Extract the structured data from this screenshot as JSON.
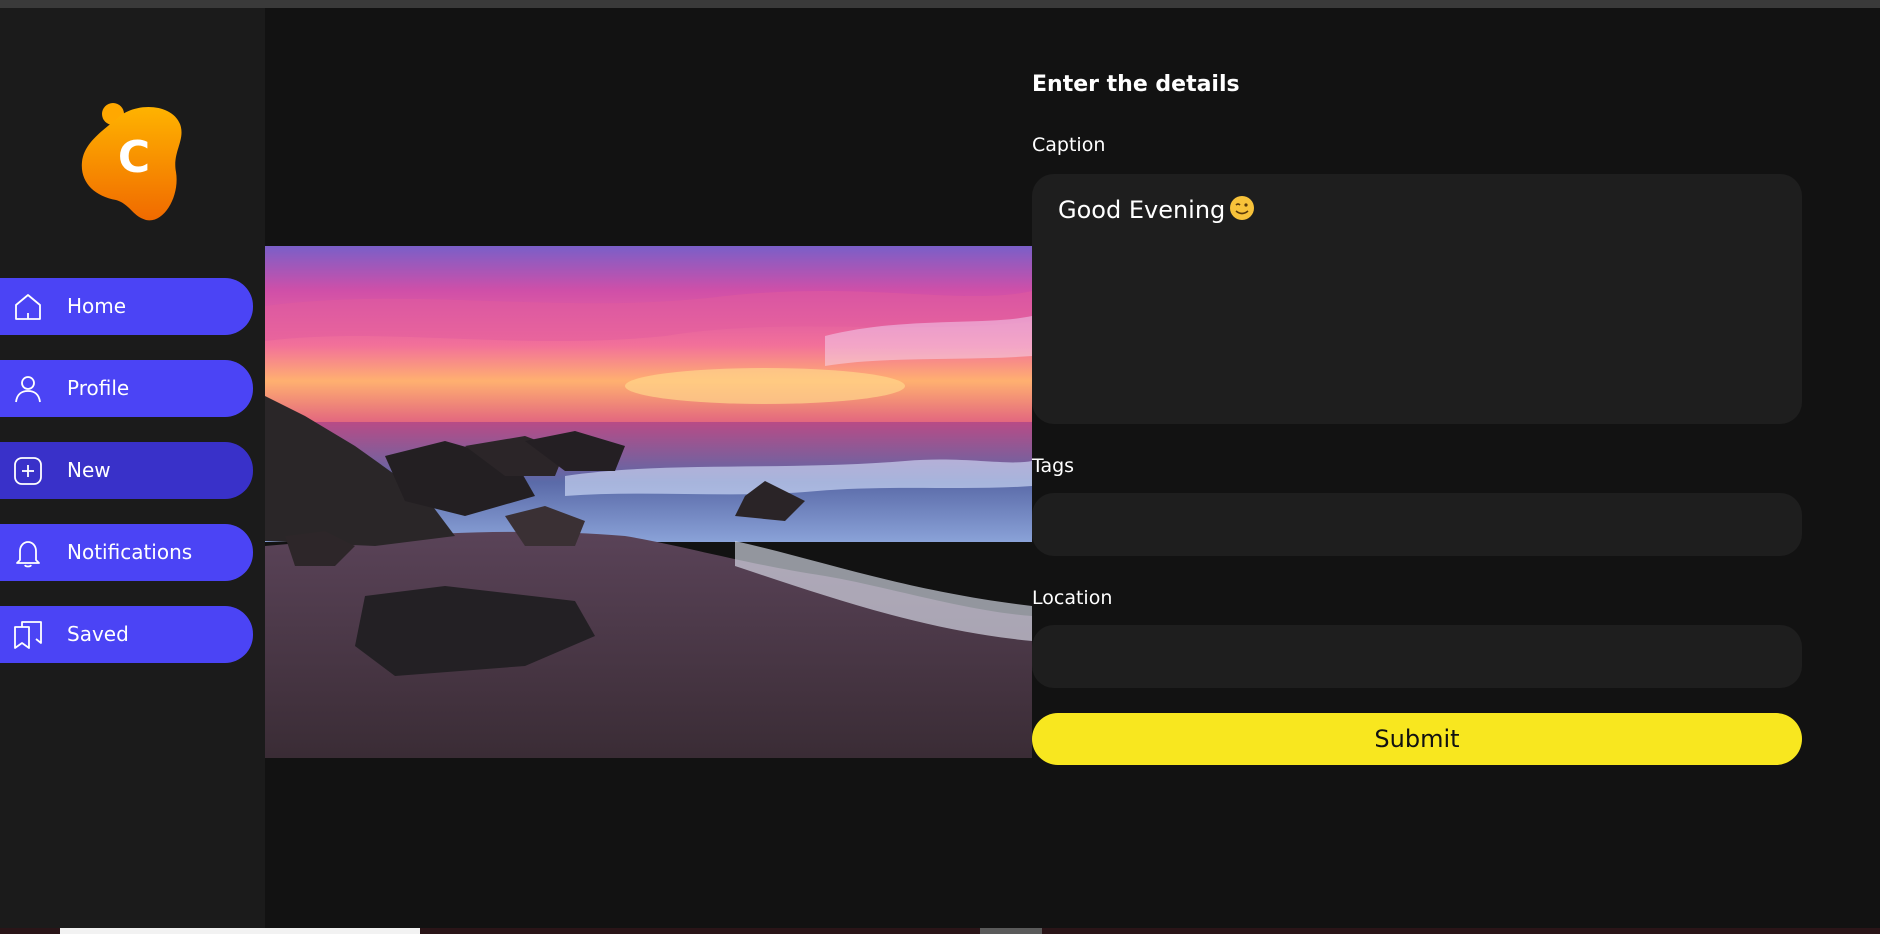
{
  "sidebar": {
    "logo_letter": "C",
    "items": [
      {
        "label": "Home",
        "icon": "home-icon"
      },
      {
        "label": "Profile",
        "icon": "user-icon"
      },
      {
        "label": "New",
        "icon": "plus-square-icon"
      },
      {
        "label": "Notifications",
        "icon": "bell-icon"
      },
      {
        "label": "Saved",
        "icon": "bookmark-icon"
      }
    ]
  },
  "form": {
    "title": "Enter the details",
    "caption_label": "Caption",
    "caption_value": "Good Evening",
    "caption_emoji": "winking-face-icon",
    "tags_label": "Tags",
    "tags_value": "",
    "location_label": "Location",
    "location_value": "",
    "submit_label": "Submit"
  },
  "colors": {
    "accent": "#4b44f5",
    "accent_active": "#3931c9",
    "submit": "#f8e71f",
    "background": "#121212",
    "sidebar": "#1b1b1b",
    "field": "#1e1e1e"
  }
}
